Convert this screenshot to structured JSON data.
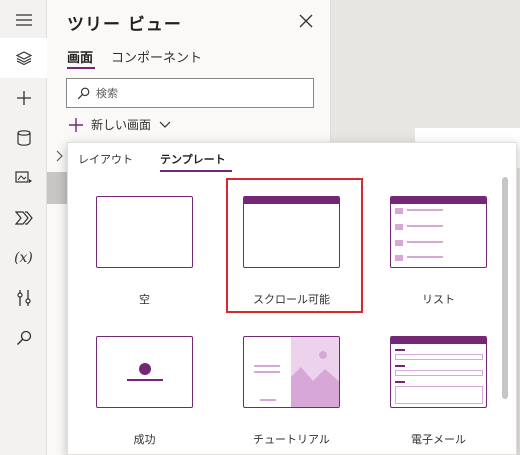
{
  "rail": {
    "items": [
      {
        "icon": "hamburger-menu-icon"
      },
      {
        "icon": "layers-icon",
        "active": true
      },
      {
        "icon": "plus-icon"
      },
      {
        "icon": "database-icon"
      },
      {
        "icon": "media-icon"
      },
      {
        "icon": "power-automate-icon"
      },
      {
        "icon": "variables-icon",
        "text": "(x)"
      },
      {
        "icon": "tools-icon"
      },
      {
        "icon": "search-icon"
      }
    ]
  },
  "tree": {
    "title": "ツリー ビュー",
    "tabs": [
      "画面",
      "コンポーネント"
    ],
    "search_placeholder": "検索",
    "new_screen_label": "新しい画面"
  },
  "popup": {
    "tabs": [
      "レイアウト",
      "テンプレート"
    ],
    "templates": [
      {
        "label": "空"
      },
      {
        "label": "スクロール可能",
        "highlighted": true
      },
      {
        "label": "リスト"
      },
      {
        "label": "成功"
      },
      {
        "label": "チュートリアル"
      },
      {
        "label": "電子メール"
      }
    ]
  },
  "colors": {
    "accent": "#742774",
    "accent_light": "#d7a8d7",
    "highlight": "#d62a2f"
  }
}
